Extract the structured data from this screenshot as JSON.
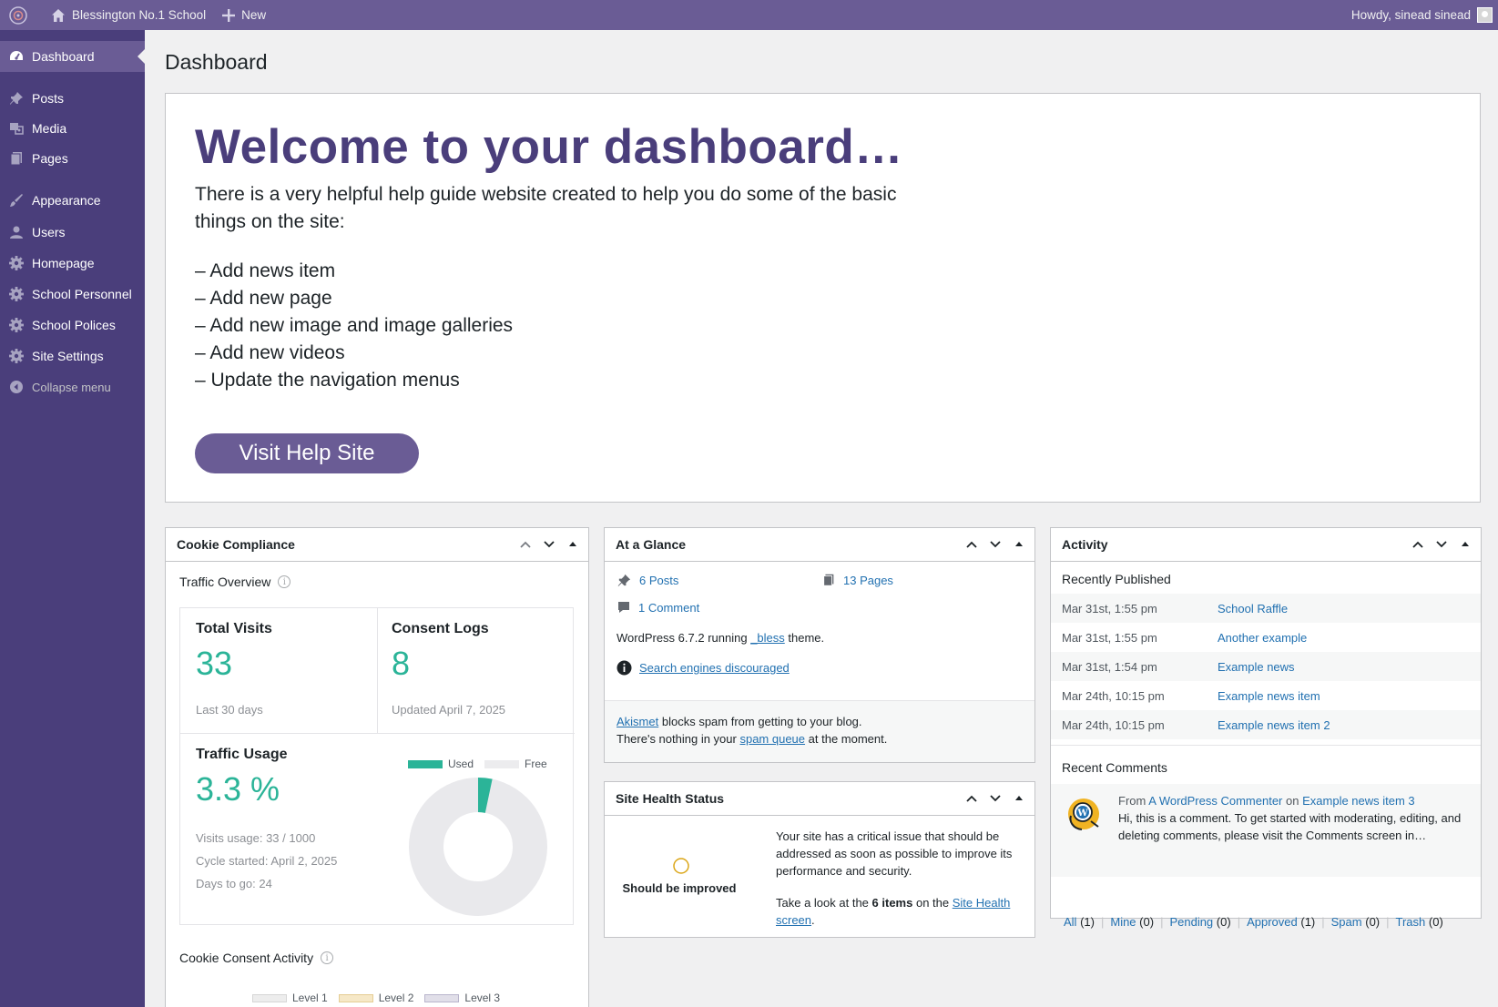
{
  "adminbar": {
    "site_name": "Blessington No.1 School",
    "new_label": "New",
    "greeting": "Howdy, sinead sinead"
  },
  "sidebar": {
    "items": [
      {
        "label": "Dashboard",
        "icon": "dashboard-icon",
        "current": true
      },
      {
        "label": "Posts",
        "icon": "pin-icon"
      },
      {
        "label": "Media",
        "icon": "media-icon"
      },
      {
        "label": "Pages",
        "icon": "pages-icon"
      },
      {
        "label": "Appearance",
        "icon": "brush-icon"
      },
      {
        "label": "Users",
        "icon": "user-icon"
      },
      {
        "label": "Homepage",
        "icon": "gear-icon"
      },
      {
        "label": "School Personnel",
        "icon": "gear-icon"
      },
      {
        "label": "School Polices",
        "icon": "gear-icon"
      },
      {
        "label": "Site Settings",
        "icon": "gear-icon"
      }
    ],
    "collapse_label": "Collapse menu"
  },
  "page_title": "Dashboard",
  "welcome": {
    "heading": "Welcome to your dashboard…",
    "intro": "There is a very helpful help guide website created to help you do some of the basic things on the site:",
    "items": [
      "– Add news item",
      "– Add new page",
      "– Add new image and image galleries",
      "– Add new videos",
      "– Update the navigation menus"
    ],
    "button_label": "Visit Help Site"
  },
  "cookie_compliance": {
    "title": "Cookie Compliance",
    "traffic_overview": "Traffic Overview",
    "total_visits_label": "Total Visits",
    "total_visits_value": "33",
    "total_visits_sub": "Last 30 days",
    "consent_logs_label": "Consent Logs",
    "consent_logs_value": "8",
    "consent_logs_sub": "Updated April 7, 2025",
    "traffic_usage_label": "Traffic Usage",
    "traffic_usage_value": "3.3 %",
    "visits_usage": "Visits usage: 33 / 1000",
    "cycle_started": "Cycle started: April 2, 2025",
    "days_to_go": "Days to go: 24",
    "legend_used": "Used",
    "legend_free": "Free",
    "used_fraction": 0.033,
    "used_color": "#2bb498",
    "free_color": "#e9e9ec",
    "consent_activity": "Cookie Consent Activity",
    "levels": [
      "Level 1",
      "Level 2",
      "Level 3"
    ],
    "level_colors": [
      "#ededed",
      "#f6e8c7",
      "#e1dfe9"
    ]
  },
  "at_a_glance": {
    "title": "At a Glance",
    "posts": "6 Posts",
    "pages": "13 Pages",
    "comments": "1 Comment",
    "wp_prefix": "WordPress 6.7.2 running",
    "theme": "_bless",
    "theme_suffix": "theme.",
    "search_discouraged": "Search engines discouraged",
    "akismet": "Akismet",
    "akismet_text": "blocks spam from getting to your blog.",
    "spam_prefix": "There's nothing in your",
    "spam_link": "spam queue",
    "spam_suffix": "at the moment."
  },
  "site_health": {
    "title": "Site Health Status",
    "status": "Should be improved",
    "message": "Your site has a critical issue that should be addressed as soon as possible to improve its performance and security.",
    "take_look_prefix": "Take a look at the",
    "items_count": "6 items",
    "on_the": "on the",
    "link_text": "Site Health screen",
    "link_suffix": "."
  },
  "activity": {
    "title": "Activity",
    "recently_published": "Recently Published",
    "posts": [
      {
        "date": "Mar 31st, 1:55 pm",
        "title": "School Raffle"
      },
      {
        "date": "Mar 31st, 1:55 pm",
        "title": "Another example"
      },
      {
        "date": "Mar 31st, 1:54 pm",
        "title": "Example news"
      },
      {
        "date": "Mar 24th, 10:15 pm",
        "title": "Example news item"
      },
      {
        "date": "Mar 24th, 10:15 pm",
        "title": "Example news item 2"
      }
    ],
    "recent_comments": "Recent Comments",
    "comment_from": "From",
    "comment_author": "A WordPress Commenter",
    "comment_on": "on",
    "comment_post": "Example news item 3",
    "comment_text": "Hi, this is a comment. To get started with moderating, editing, and deleting comments, please visit the Comments screen in…",
    "filters": [
      {
        "label": "All",
        "count": "(1)"
      },
      {
        "label": "Mine",
        "count": "(0)"
      },
      {
        "label": "Pending",
        "count": "(0)"
      },
      {
        "label": "Approved",
        "count": "(1)"
      },
      {
        "label": "Spam",
        "count": "(0)"
      },
      {
        "label": "Trash",
        "count": "(0)"
      }
    ]
  }
}
